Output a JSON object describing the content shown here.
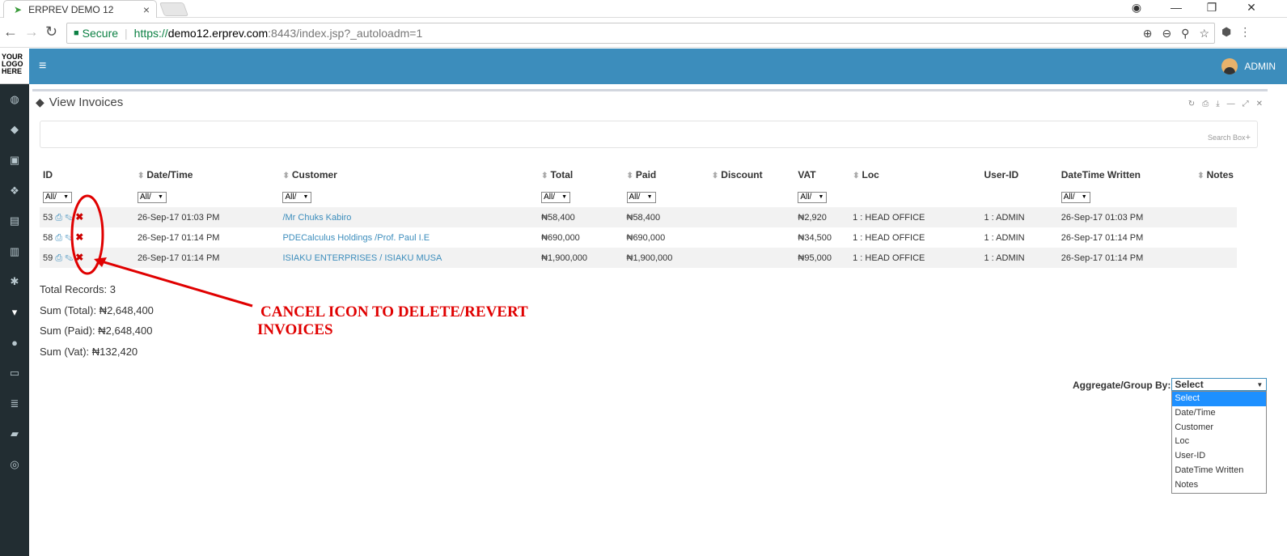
{
  "browser": {
    "tab_title": "ERPREV DEMO 12",
    "tab_close": "×",
    "secure_label": "Secure",
    "url_scheme": "https://",
    "url_host": "demo12.erprev.com",
    "url_path": ":8443/index.jsp?_autoloadm=1"
  },
  "logo": [
    "YOUR",
    "LOGO",
    "HERE"
  ],
  "header": {
    "user": "ADMIN"
  },
  "page": {
    "title": "View Invoices",
    "search_label": "Search Box"
  },
  "table": {
    "columns": [
      "ID",
      "Date/Time",
      "Customer",
      "Total",
      "Paid",
      "Discount",
      "VAT",
      "Loc",
      "User-ID",
      "DateTime Written",
      "Notes"
    ],
    "filter_value": "All/",
    "rows": [
      {
        "id": "53",
        "datetime": "26-Sep-17 01:03 PM",
        "customer": "/Mr Chuks Kabiro",
        "total": "₦58,400",
        "paid": "₦58,400",
        "discount": "",
        "vat": "₦2,920",
        "loc": "1 : HEAD OFFICE",
        "user": "1 : ADMIN",
        "written": "26-Sep-17 01:03 PM",
        "notes": ""
      },
      {
        "id": "58",
        "datetime": "26-Sep-17 01:14 PM",
        "customer": "PDECalculus Holdings /Prof. Paul I.E",
        "total": "₦690,000",
        "paid": "₦690,000",
        "discount": "",
        "vat": "₦34,500",
        "loc": "1 : HEAD OFFICE",
        "user": "1 : ADMIN",
        "written": "26-Sep-17 01:14 PM",
        "notes": ""
      },
      {
        "id": "59",
        "datetime": "26-Sep-17 01:14 PM",
        "customer": "ISIAKU ENTERPRISES / ISIAKU MUSA",
        "total": "₦1,900,000",
        "paid": "₦1,900,000",
        "discount": "",
        "vat": "₦95,000",
        "loc": "1 : HEAD OFFICE",
        "user": "1 : ADMIN",
        "written": "26-Sep-17 01:14 PM",
        "notes": ""
      }
    ]
  },
  "summary": {
    "total_records": "Total Records: 3",
    "sum_total": "Sum (Total): ₦2,648,400",
    "sum_paid": "Sum (Paid): ₦2,648,400",
    "sum_vat": "Sum (Vat): ₦132,420"
  },
  "annotation": {
    "line1": "CANCEL ICON TO DELETE/REVERT",
    "line2": "INVOICES",
    "color": "#e00000"
  },
  "aggregate": {
    "label": "Aggregate/Group By:",
    "selected": "Select",
    "options": [
      "Select",
      "Date/Time",
      "Customer",
      "Loc",
      "User-ID",
      "DateTime Written",
      "Notes"
    ]
  },
  "colors": {
    "header": "#3c8dbc",
    "sidebar": "#222d32",
    "link": "#3c8dbc"
  }
}
